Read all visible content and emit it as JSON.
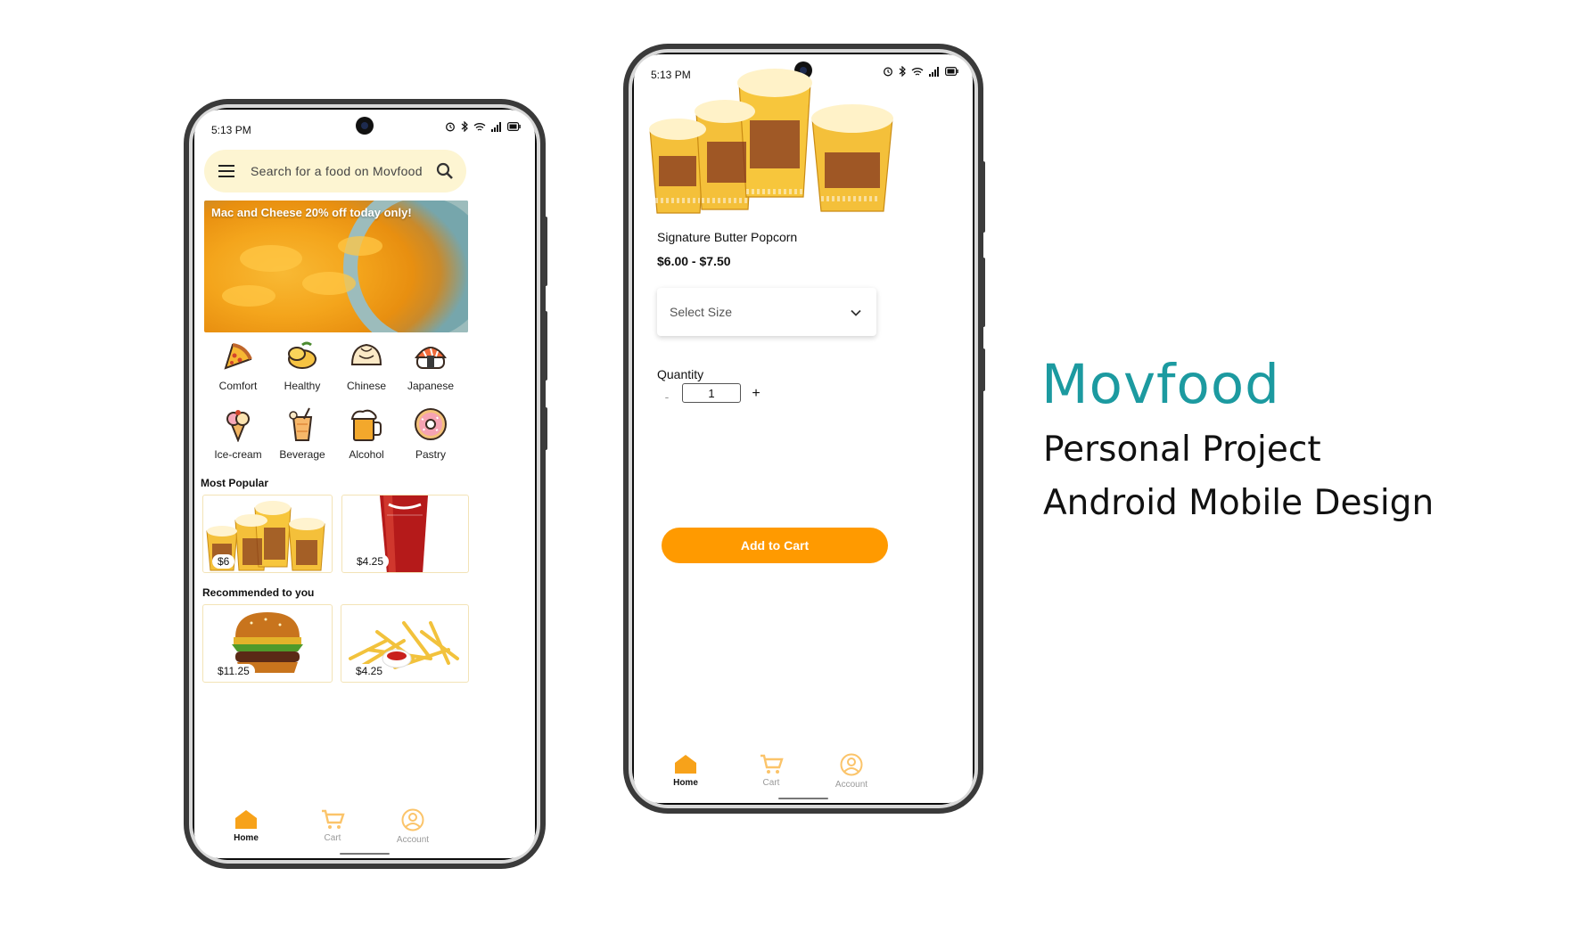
{
  "status_bar": {
    "time": "5:13 PM"
  },
  "home_screen": {
    "search": {
      "placeholder": "Search for a food on Movfood"
    },
    "banner": {
      "text": "Mac and Cheese 20% off today only!"
    },
    "categories": [
      {
        "label": "Comfort",
        "icon": "pizza-icon"
      },
      {
        "label": "Healthy",
        "icon": "mango-icon"
      },
      {
        "label": "Chinese",
        "icon": "dumpling-icon"
      },
      {
        "label": "Japanese",
        "icon": "sushi-icon"
      },
      {
        "label": "Ice-cream",
        "icon": "ice-cream-icon"
      },
      {
        "label": "Beverage",
        "icon": "beverage-icon"
      },
      {
        "label": "Alcohol",
        "icon": "beer-icon"
      },
      {
        "label": "Pastry",
        "icon": "donut-icon"
      }
    ],
    "most_popular": {
      "title": "Most Popular",
      "items": [
        {
          "price": "$6",
          "image": "popcorn-image"
        },
        {
          "price": "$4.25",
          "image": "cola-image"
        }
      ]
    },
    "recommended": {
      "title": "Recommended to you",
      "items": [
        {
          "price": "$11.25",
          "image": "burger-image"
        },
        {
          "price": "$4.25",
          "image": "fries-image"
        }
      ]
    }
  },
  "product_screen": {
    "name": "Signature Butter Popcorn",
    "price": "$6.00 - $7.50",
    "size_select": {
      "placeholder": "Select Size"
    },
    "quantity": {
      "label": "Quantity",
      "value": "1",
      "minus": "-",
      "plus": "+"
    },
    "add_button": "Add to Cart"
  },
  "nav": {
    "home": "Home",
    "cart": "Cart",
    "account": "Account"
  },
  "branding": {
    "title": "Movfood",
    "subtitle1": "Personal Project",
    "subtitle2": "Android Mobile Design"
  },
  "colors": {
    "accent": "#ff9a00",
    "brand_teal": "#1c9aa0",
    "search_bg": "#fdf5d2"
  }
}
